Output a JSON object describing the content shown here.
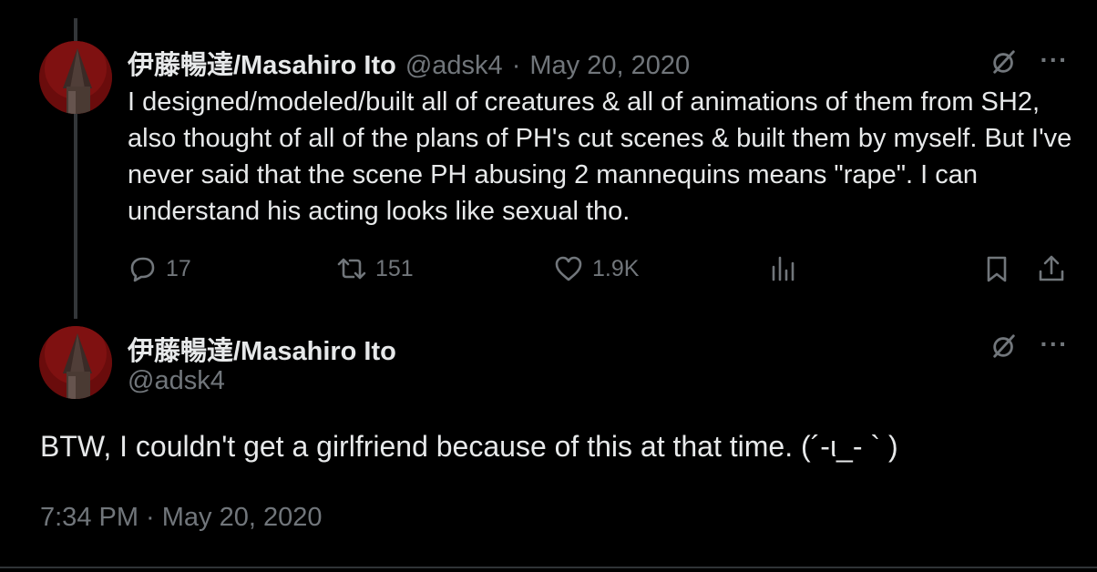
{
  "reply_tweet": {
    "display_name": "伊藤暢達/Masahiro Ito",
    "handle": "@adsk4",
    "separator": "·",
    "date": "May 20, 2020",
    "text": "I designed/modeled/built all of creatures & all of animations of them from SH2, also thought of all of the plans of PH's cut scenes & built them by myself. But I've never said that the scene PH abusing 2 mannequins means \"rape\". I can understand his acting looks like sexual tho.",
    "more_label": "···",
    "stats": {
      "replies": "17",
      "reposts": "151",
      "likes": "1.9K"
    }
  },
  "main_tweet": {
    "display_name": "伊藤暢達/Masahiro Ito",
    "handle": "@adsk4",
    "more_label": "···",
    "text": "BTW, I couldn't get a girlfriend because of this at that time. (´-ι_- ` )",
    "timestamp": "7:34 PM · May 20, 2020"
  },
  "icons": {
    "grok": "grok-slash-circle-icon",
    "reply": "reply-bubble-icon",
    "repost": "repost-arrows-icon",
    "like": "heart-icon",
    "views": "views-bar-chart-icon",
    "bookmark": "bookmark-icon",
    "share": "share-upload-icon"
  },
  "colors": {
    "background": "#000000",
    "text_primary": "#e7e9ea",
    "text_secondary": "#71767b",
    "thread_line": "#333639",
    "divider": "#2f3336"
  }
}
